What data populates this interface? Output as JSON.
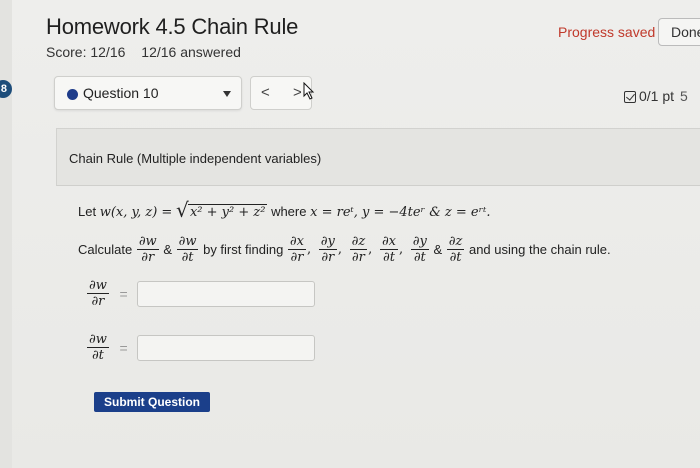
{
  "header": {
    "title": "Homework 4.5 Chain Rule",
    "score": "Score: 12/16",
    "answered": "12/16 answered",
    "progress": "Progress saved",
    "done_label": "Done"
  },
  "left_badge": "8",
  "question_nav": {
    "selected": "Question 10",
    "prev": "<",
    "next": ">"
  },
  "points": "0/1 pt",
  "points_tail": "5",
  "problem": {
    "heading": "Chain Rule (Multiple independent variables)",
    "let_prefix": "Let",
    "func": "w(x, y, z) =",
    "radicand": "x² + y² + z²",
    "where": "where",
    "defs": "x = reᵗ, y = −4teʳ & z = eʳᵗ.",
    "calculate": "Calculate",
    "amp": "&",
    "by_first": "by first finding",
    "and_using": "and using the chain rule.",
    "partials_target": [
      {
        "num": "∂w",
        "den": "∂r"
      },
      {
        "num": "∂w",
        "den": "∂t"
      }
    ],
    "partials_find": [
      {
        "num": "∂x",
        "den": "∂r"
      },
      {
        "num": "∂y",
        "den": "∂r"
      },
      {
        "num": "∂z",
        "den": "∂r"
      },
      {
        "num": "∂x",
        "den": "∂t"
      },
      {
        "num": "∂y",
        "den": "∂t"
      },
      {
        "num": "∂z",
        "den": "∂t"
      }
    ],
    "answers": [
      {
        "num": "∂w",
        "den": "∂r",
        "eq": "=",
        "value": ""
      },
      {
        "num": "∂w",
        "den": "∂t",
        "eq": "=",
        "value": ""
      }
    ],
    "submit_label": "Submit Question"
  },
  "colors": {
    "accent": "#1b3f8a",
    "progress": "#c0392b",
    "badge": "#1d4d7a"
  }
}
